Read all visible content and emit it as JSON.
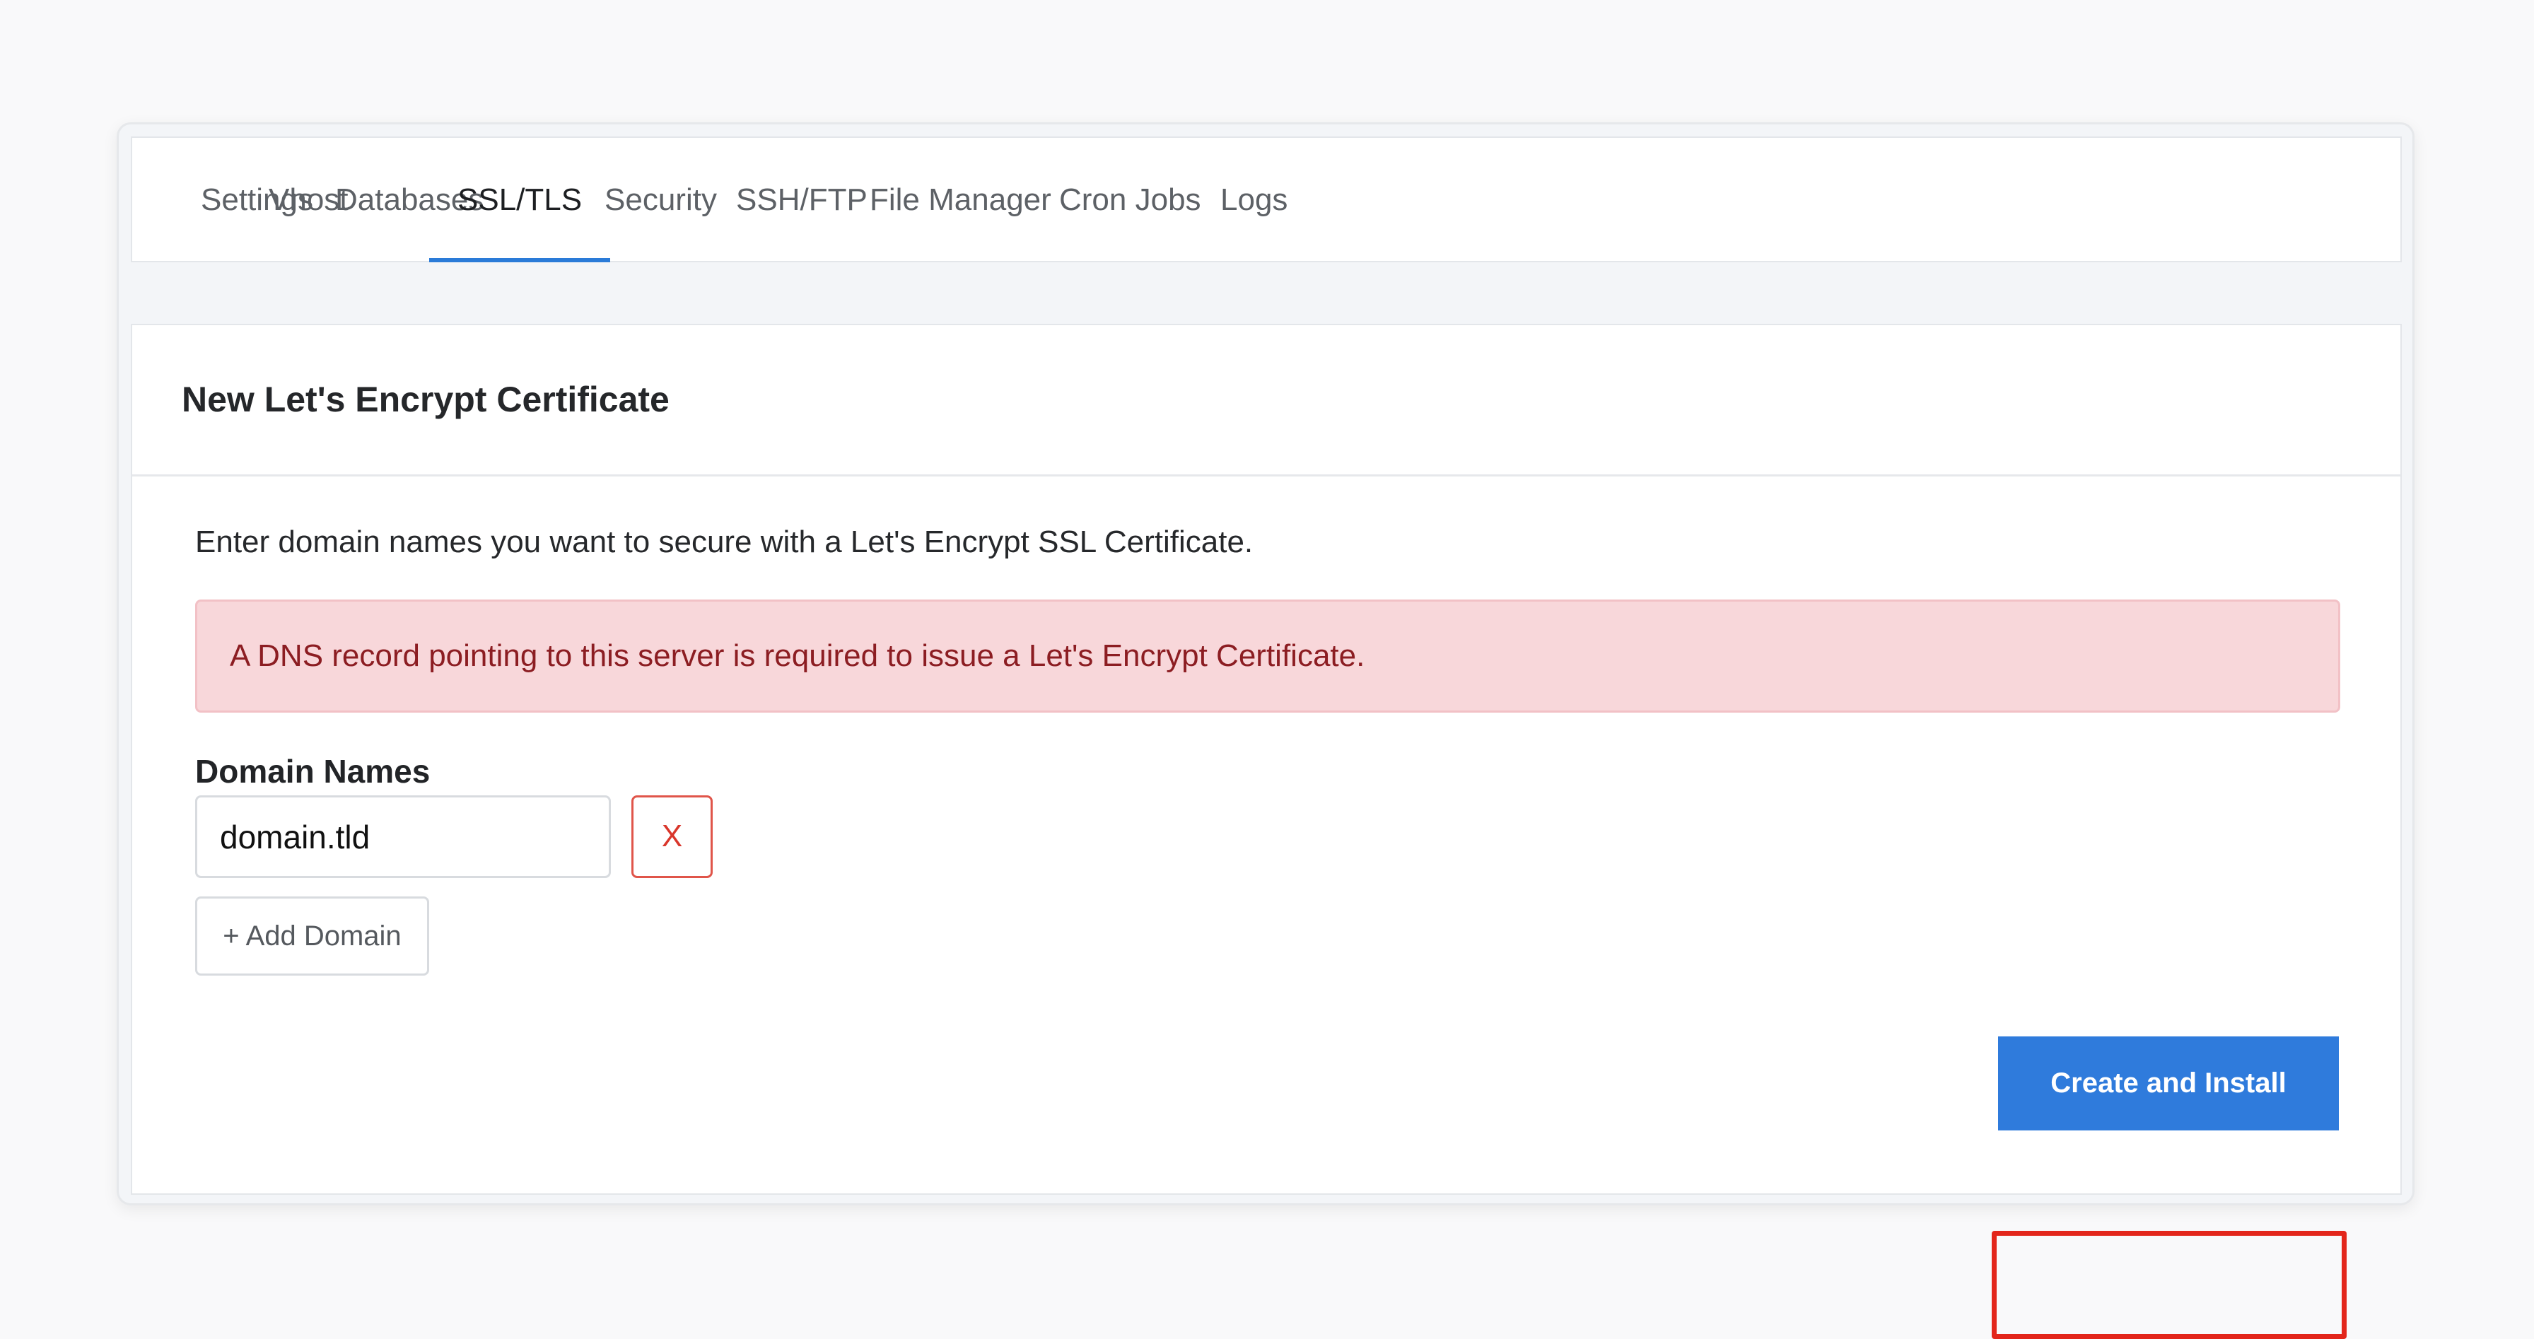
{
  "tabs": [
    {
      "label": "Settings"
    },
    {
      "label": "Vhost"
    },
    {
      "label": "Databases"
    },
    {
      "label": "SSL/TLS",
      "active": true
    },
    {
      "label": "Security"
    },
    {
      "label": "SSH/FTP"
    },
    {
      "label": "File Manager"
    },
    {
      "label": "Cron Jobs"
    },
    {
      "label": "Logs"
    }
  ],
  "card": {
    "title": "New Let's Encrypt Certificate",
    "intro": "Enter domain names you want to secure with a Let's Encrypt SSL Certificate.",
    "alert": "A DNS record pointing to this server is required to issue a Let's Encrypt Certificate.",
    "domains_label": "Domain Names",
    "domain_value": "domain.tld",
    "remove_label": "X",
    "add_domain_label": "+ Add Domain",
    "submit_label": "Create and Install"
  },
  "colors": {
    "accent": "#2f7bdc",
    "alert_bg": "#f8d7da",
    "alert_text": "#8c1d22",
    "danger": "#d9362b",
    "highlight": "#e3261b"
  }
}
